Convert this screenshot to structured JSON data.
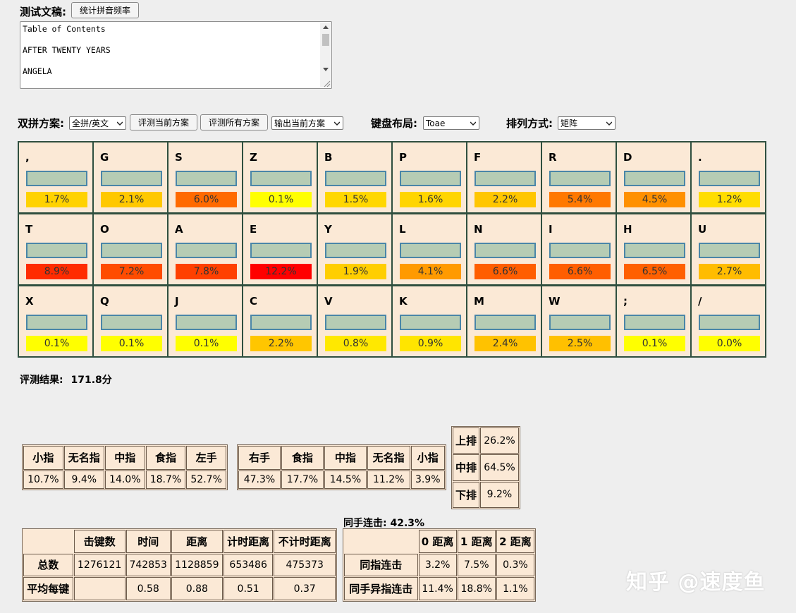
{
  "header": {
    "doc_label": "测试文稿:",
    "count_button": "统计拼音频率",
    "textarea_lines": [
      "Table of Contents",
      "",
      "AFTER TWENTY YEARS",
      "",
      "ANGELA"
    ]
  },
  "toolbar": {
    "scheme_label": "双拼方案:",
    "scheme_value": "全拼/英文",
    "eval_current": "评测当前方案",
    "eval_all": "评测所有方案",
    "export_value": "输出当前方案",
    "layout_label": "键盘布局:",
    "layout_value": "Toae",
    "arrange_label": "排列方式:",
    "arrange_value": "矩阵"
  },
  "keyboard": {
    "rows": [
      [
        {
          "letter": ",",
          "freq": "1.7%",
          "color": "#ffd200"
        },
        {
          "letter": "G",
          "freq": "2.1%",
          "color": "#ffc800"
        },
        {
          "letter": "S",
          "freq": "6.0%",
          "color": "#ff6a00"
        },
        {
          "letter": "Z",
          "freq": "0.1%",
          "color": "#ffff00"
        },
        {
          "letter": "B",
          "freq": "1.5%",
          "color": "#ffd700"
        },
        {
          "letter": "P",
          "freq": "1.6%",
          "color": "#ffd500"
        },
        {
          "letter": "F",
          "freq": "2.2%",
          "color": "#ffc600"
        },
        {
          "letter": "R",
          "freq": "5.4%",
          "color": "#ff7800"
        },
        {
          "letter": "D",
          "freq": "4.5%",
          "color": "#ff9000"
        },
        {
          "letter": ".",
          "freq": "1.2%",
          "color": "#ffdd00"
        }
      ],
      [
        {
          "letter": "T",
          "freq": "8.9%",
          "color": "#ff2c00"
        },
        {
          "letter": "O",
          "freq": "7.2%",
          "color": "#ff4c00"
        },
        {
          "letter": "A",
          "freq": "7.8%",
          "color": "#ff4000"
        },
        {
          "letter": "E",
          "freq": "12.2%",
          "color": "#ff0000"
        },
        {
          "letter": "Y",
          "freq": "1.9%",
          "color": "#ffce00"
        },
        {
          "letter": "L",
          "freq": "4.1%",
          "color": "#ff9a00"
        },
        {
          "letter": "N",
          "freq": "6.6%",
          "color": "#ff5e00"
        },
        {
          "letter": "I",
          "freq": "6.6%",
          "color": "#ff5e00"
        },
        {
          "letter": "H",
          "freq": "6.5%",
          "color": "#ff6000"
        },
        {
          "letter": "U",
          "freq": "2.7%",
          "color": "#ffbc00"
        }
      ],
      [
        {
          "letter": "X",
          "freq": "0.1%",
          "color": "#ffff00"
        },
        {
          "letter": "Q",
          "freq": "0.1%",
          "color": "#ffff00"
        },
        {
          "letter": "J",
          "freq": "0.1%",
          "color": "#ffff00"
        },
        {
          "letter": "C",
          "freq": "2.2%",
          "color": "#ffc600"
        },
        {
          "letter": "V",
          "freq": "0.8%",
          "color": "#ffe800"
        },
        {
          "letter": "K",
          "freq": "0.9%",
          "color": "#ffe500"
        },
        {
          "letter": "M",
          "freq": "2.4%",
          "color": "#ffc200"
        },
        {
          "letter": "W",
          "freq": "2.5%",
          "color": "#ffc000"
        },
        {
          "letter": ";",
          "freq": "0.1%",
          "color": "#ffff00"
        },
        {
          "letter": "/",
          "freq": "0.0%",
          "color": "#ffff00"
        }
      ]
    ]
  },
  "result": {
    "label": "评测结果:",
    "score": "171.8分"
  },
  "left_hand": {
    "headers": [
      "小指",
      "无名指",
      "中指",
      "食指",
      "左手"
    ],
    "values": [
      "10.7%",
      "9.4%",
      "14.0%",
      "18.7%",
      "52.7%"
    ]
  },
  "right_hand": {
    "headers": [
      "右手",
      "食指",
      "中指",
      "无名指",
      "小指"
    ],
    "values": [
      "47.3%",
      "17.7%",
      "14.5%",
      "11.2%",
      "3.9%"
    ]
  },
  "rows_table": [
    {
      "label": "上排",
      "value": "26.2%"
    },
    {
      "label": "中排",
      "value": "64.5%"
    },
    {
      "label": "下排",
      "value": "9.2%"
    }
  ],
  "stats": {
    "headers": [
      "",
      "击键数",
      "时间",
      "距离",
      "计时距离",
      "不计时距离"
    ],
    "rows": [
      [
        "总数",
        "1276121",
        "742853",
        "1128859",
        "653486",
        "475373"
      ],
      [
        "平均每键",
        "",
        "0.58",
        "0.88",
        "0.51",
        "0.37"
      ]
    ]
  },
  "same_hand": {
    "caption": "同手连击: 42.3%",
    "headers": [
      "",
      "0 距离",
      "1 距离",
      "2 距离"
    ],
    "rows": [
      [
        "同指连击",
        "3.2%",
        "7.5%",
        "0.3%"
      ],
      [
        "同手异指连击",
        "11.4%",
        "18.8%",
        "1.1%"
      ]
    ]
  },
  "watermark": "知乎 @速度鱼"
}
